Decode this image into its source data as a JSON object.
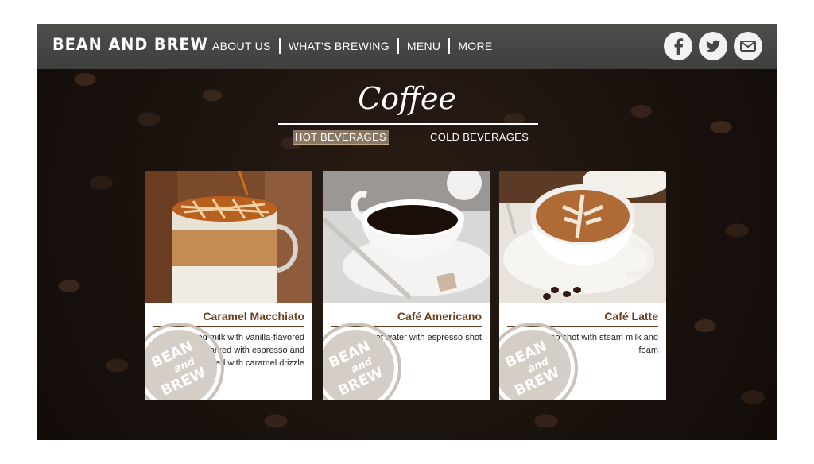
{
  "brand": "BEAN AND BREW",
  "nav": [
    {
      "label": "ABOUT US"
    },
    {
      "label": "WHAT'S BREWING"
    },
    {
      "label": "MENU"
    },
    {
      "label": "MORE"
    }
  ],
  "social": [
    {
      "icon": "facebook-icon"
    },
    {
      "icon": "twitter-icon"
    },
    {
      "icon": "email-icon"
    }
  ],
  "page_title": "Coffee",
  "tabs": [
    {
      "label": "HOT BEVERAGES",
      "active": true
    },
    {
      "label": "COLD BEVERAGES",
      "active": false
    }
  ],
  "items": [
    {
      "name": "Caramel Macchiato",
      "description": "Steamed milk with vanilla-flavored syrup, marked with espresso and topped with caramel drizzle"
    },
    {
      "name": "Café Americano",
      "description": "Hot water with espresso shot"
    },
    {
      "name": "Café Latte",
      "description": "Espresso shot with steam milk and foam"
    }
  ],
  "badge": {
    "line1": "BEAN",
    "line2": "and",
    "line3": "BREW"
  },
  "colors": {
    "accent": "#6a3d1e",
    "tab_active": "#8a7763",
    "topbar": "#454544"
  }
}
